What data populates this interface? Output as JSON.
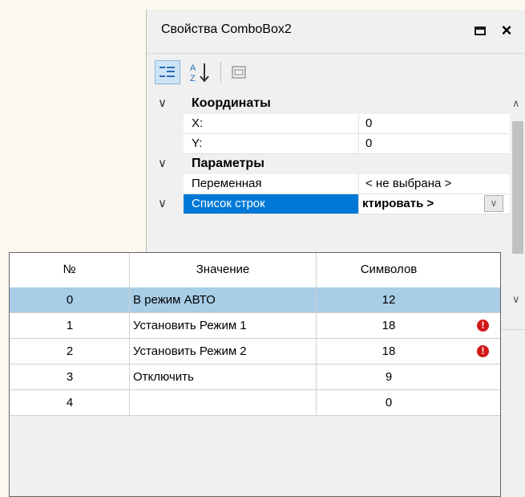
{
  "panel": {
    "title": "Свойства ComboBox2",
    "restore_icon": "restore-window-icon",
    "close_label": "×"
  },
  "toolbar": {
    "categorized_icon": "categorized-icon",
    "alphabetical_icon": "sort-alphabetical-icon",
    "property_pages_icon": "property-pages-icon"
  },
  "properties": {
    "categories": [
      {
        "label": "Координаты",
        "items": [
          {
            "name": "X:",
            "value": "0"
          },
          {
            "name": "Y:",
            "value": "0"
          }
        ]
      },
      {
        "label": "Параметры",
        "items": [
          {
            "name": "Переменная",
            "value": "< не выбрана >"
          }
        ]
      }
    ],
    "selected": {
      "name": "Список строк",
      "value": "ктировать >"
    }
  },
  "popup": {
    "columns": [
      "№",
      "Значение",
      "Символов"
    ],
    "rows": [
      {
        "num": "0",
        "value": "В режим АВТО",
        "chars": "12",
        "warning": false
      },
      {
        "num": "1",
        "value": "Установить Режим 1",
        "chars": "18",
        "warning": true
      },
      {
        "num": "2",
        "value": "Установить Режим 2",
        "chars": "18",
        "warning": true
      },
      {
        "num": "3",
        "value": "Отключить",
        "chars": "9",
        "warning": false
      },
      {
        "num": "4",
        "value": "",
        "chars": "0",
        "warning": false
      }
    ],
    "warning_icon": "warning-icon",
    "warning_glyph": "!"
  },
  "colors": {
    "selected_row": "#a8cde7",
    "selected_property": "#0078d7",
    "warning": "#d11818",
    "background": "#fdf8ed"
  }
}
